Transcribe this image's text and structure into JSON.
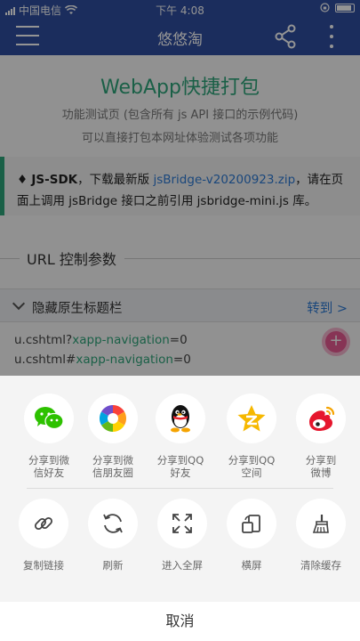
{
  "status_bar": {
    "carrier": "中国电信",
    "time": "下午 4:08"
  },
  "navbar": {
    "title": "悠悠淘"
  },
  "page": {
    "app_title": "WebApp快捷打包",
    "subtitle1": "功能测试页 (包含所有 js API 接口的示例代码)",
    "subtitle2": "可以直接打包本网址体验测试各项功能",
    "notice": {
      "bullet": "♦ ",
      "bold": "JS-SDK",
      "text1": "，下载最新版 ",
      "link": "jsBridge-v20200923.zip",
      "text2": "，请在页面上调用 jsBridge 接口之前引用 jsbridge-mini.js 库。"
    },
    "section_title": "URL 控制参数",
    "row": {
      "label": "隐藏原生标题栏",
      "goto": "转到 >"
    },
    "code1": {
      "prefix": "u.cshtml?",
      "param": "xapp-navigation",
      "suffix": "=0"
    },
    "code2": {
      "prefix": "u.cshtml#",
      "param": "xapp-navigation",
      "suffix": "=0"
    },
    "fab_symbol": "+"
  },
  "share_sheet": {
    "row1": [
      {
        "icon": "wechat-icon",
        "label": "分享到微\n信好友"
      },
      {
        "icon": "moments-icon",
        "label": "分享到微\n信朋友圈"
      },
      {
        "icon": "qq-icon",
        "label": "分享到QQ\n好友"
      },
      {
        "icon": "qzone-icon",
        "label": "分享到QQ\n空间"
      },
      {
        "icon": "weibo-icon",
        "label": "分享到\n微博"
      }
    ],
    "row2": [
      {
        "icon": "link-icon",
        "label": "复制链接"
      },
      {
        "icon": "refresh-icon",
        "label": "刷新"
      },
      {
        "icon": "fullscreen-icon",
        "label": "进入全屏"
      },
      {
        "icon": "rotate-icon",
        "label": "横屏"
      },
      {
        "icon": "broom-icon",
        "label": "清除缓存"
      }
    ],
    "cancel": "取消"
  },
  "colors": {
    "navbar": "#2f4ea0",
    "accent_green": "#2ea57a",
    "link_blue": "#2e7bd6",
    "wechat_green": "#2dc100",
    "qzone_yellow": "#f6b800",
    "weibo_red": "#e6162d"
  }
}
